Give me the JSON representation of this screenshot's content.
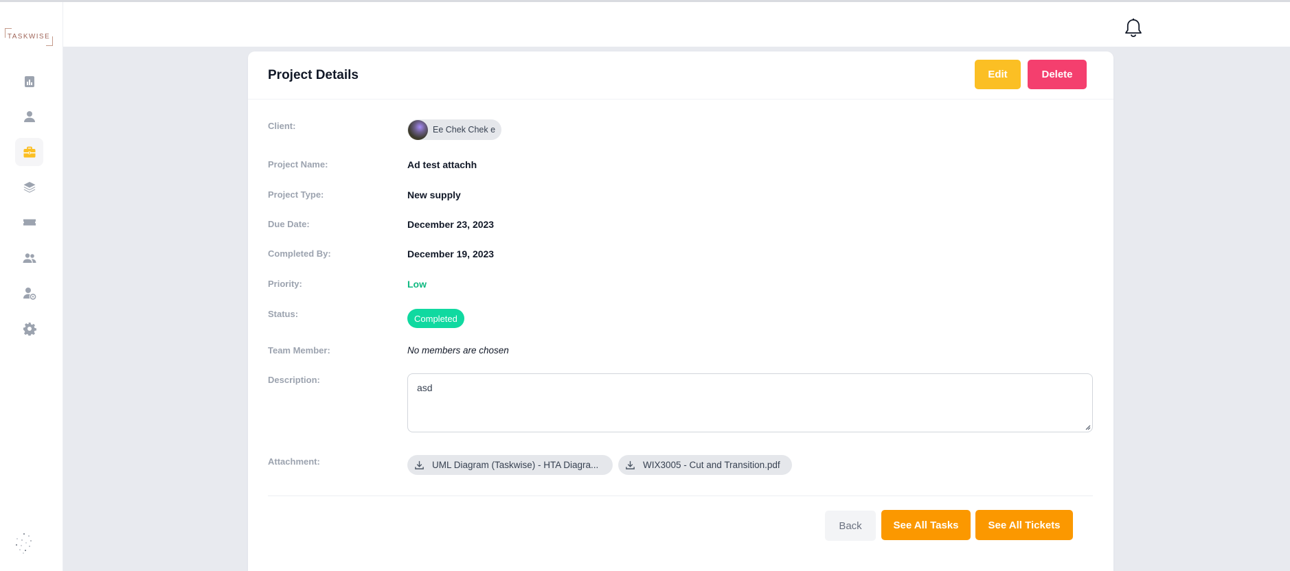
{
  "app": {
    "logo_text": "TASKWISE"
  },
  "sidebar": {
    "items": [
      {
        "icon": "chart-icon",
        "active": false
      },
      {
        "icon": "user-icon",
        "active": false
      },
      {
        "icon": "briefcase-icon",
        "active": true
      },
      {
        "icon": "layers-icon",
        "active": false
      },
      {
        "icon": "ticket-icon",
        "active": false
      },
      {
        "icon": "users-icon",
        "active": false
      },
      {
        "icon": "user-settings-icon",
        "active": false
      },
      {
        "icon": "gear-icon",
        "active": false
      }
    ]
  },
  "header": {
    "notification_icon": "bell-icon"
  },
  "project": {
    "title": "Project Details",
    "edit_label": "Edit",
    "delete_label": "Delete",
    "fields": {
      "client_label": "Client:",
      "client_name": "Ee Chek Chek e",
      "name_label": "Project Name:",
      "name_value": "Ad test attachh",
      "type_label": "Project Type:",
      "type_value": "New supply",
      "due_label": "Due Date:",
      "due_value": "December 23, 2023",
      "completed_label": "Completed By:",
      "completed_value": "December 19, 2023",
      "priority_label": "Priority:",
      "priority_value": "Low",
      "status_label": "Status:",
      "status_value": "Completed",
      "team_label": "Team Member:",
      "team_value": "No members are chosen",
      "description_label": "Description:",
      "description_value": "asd",
      "attachment_label": "Attachment:"
    },
    "attachments": [
      {
        "name": "UML Diagram (Taskwise) - HTA Diagra..."
      },
      {
        "name": "WIX3005 - Cut and Transition.pdf"
      }
    ],
    "back_label": "Back",
    "tasks_label": "See All Tasks",
    "tickets_label": "See All Tickets"
  },
  "colors": {
    "accent_orange": "#fb9800",
    "edit_yellow": "#fbbf24",
    "delete_pink": "#f43f6e",
    "status_green": "#10d9a0",
    "priority_low": "#10b981"
  }
}
